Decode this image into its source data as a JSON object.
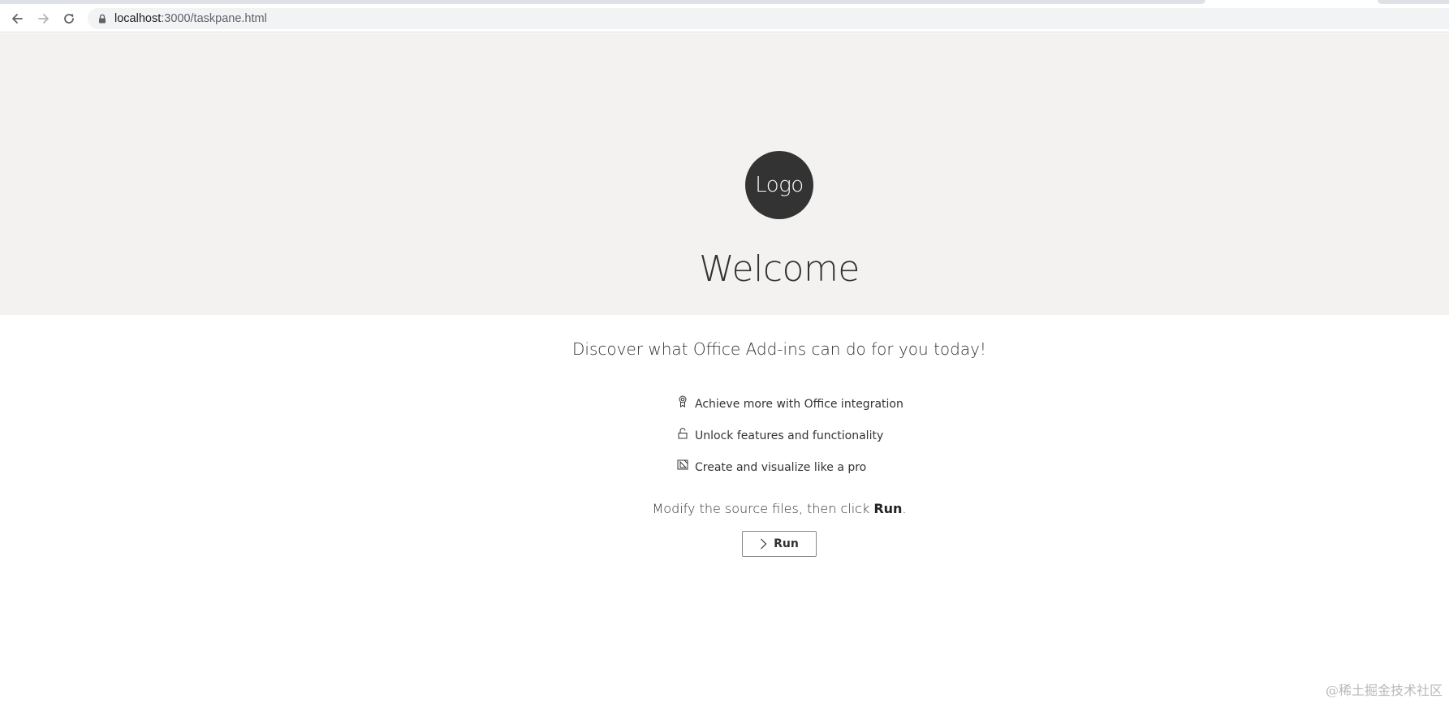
{
  "browser": {
    "url_host": "localhost",
    "url_path": ":3000/taskpane.html",
    "icons": {
      "back": "arrow-left-icon",
      "forward": "arrow-right-icon",
      "reload": "reload-icon",
      "lock": "lock-icon"
    }
  },
  "header": {
    "logo_text": "Logo",
    "welcome": "Welcome",
    "background_color": "#f3f2f1"
  },
  "main": {
    "subtitle": "Discover what Office Add-ins can do for you today!",
    "features": [
      {
        "icon": "ribbon-icon",
        "label": "Achieve more with Office integration"
      },
      {
        "icon": "unlock-icon",
        "label": "Unlock features and functionality"
      },
      {
        "icon": "design-icon",
        "label": "Create and visualize like a pro"
      }
    ],
    "instructions_prefix": "Modify the source files, then click ",
    "instructions_bold": "Run",
    "instructions_suffix": ".",
    "run_button_label": "Run"
  },
  "watermark": "@稀土掘金技术社区"
}
